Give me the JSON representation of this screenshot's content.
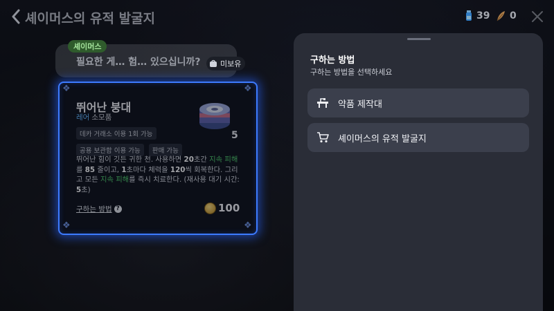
{
  "header": {
    "title": "셰이머스의 유적 발굴지",
    "currency_1": {
      "icon": "potion-icon",
      "value": "39"
    },
    "currency_2": {
      "icon": "feather-icon",
      "value": "0"
    }
  },
  "dialog": {
    "speaker": "셰이머스",
    "text": "필요한 게… 험… 있으십니까?"
  },
  "item_card": {
    "name": "뛰어난 붕대",
    "rarity": "레어",
    "category": "소모품",
    "chips": [
      "데카 거래소 이용 1회 가능",
      "공용 보관함 이용 가능",
      "판매 가능"
    ],
    "owned_badge": "미보유",
    "count": "5",
    "description": {
      "p1": "뛰어난 힘이 깃든 귀한 천. 사용하면 ",
      "b1": "20",
      "p2": "초간 ",
      "g1": "지속 피해",
      "p3": "를 ",
      "b2": "85",
      "p4": " 줄이고, ",
      "b3": "1",
      "p5": "초마다 체력을 ",
      "b4": "120",
      "p6": "씩 회복한다. 그리고 모든 ",
      "g2": "지속 피해",
      "p7": "를 즉시 치료한다. (재사용 대기 시간: ",
      "b5": "5",
      "p8": "초)"
    },
    "howto_label": "구하는 방법",
    "price": "100"
  },
  "panel": {
    "title": "구하는 방법",
    "subtitle": "구하는 방법을 선택하세요",
    "options": [
      {
        "label": "약품 제작대",
        "icon": "crafting-table-icon"
      },
      {
        "label": "셰이머스의 유적 발굴지",
        "icon": "cart-icon"
      }
    ]
  },
  "colors": {
    "accent_blue": "#3d7bff",
    "rarity_blue": "#62b8ff",
    "status_green": "#4ecb6a",
    "panel_bg": "#2a2d37",
    "option_bg": "#3b3f4c"
  }
}
